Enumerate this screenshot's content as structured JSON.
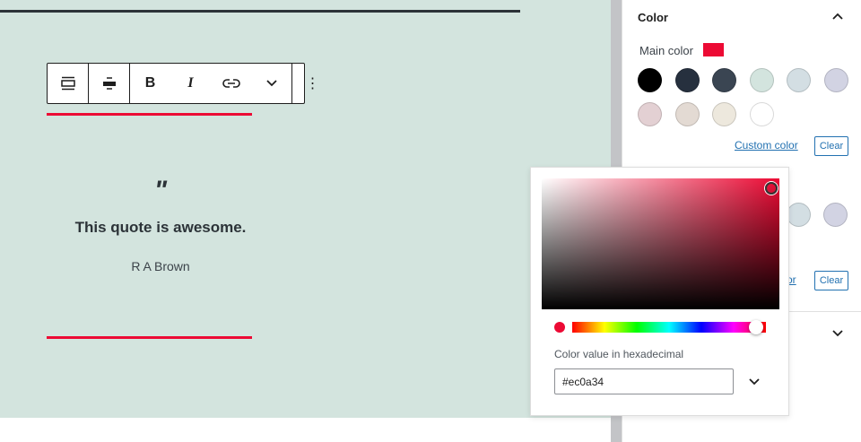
{
  "toolbar": {
    "buttons": [
      {
        "name": "block-type",
        "icon": "▭"
      },
      {
        "name": "align",
        "icon": "▬"
      },
      {
        "name": "bold",
        "icon": "B"
      },
      {
        "name": "italic",
        "icon": "I"
      },
      {
        "name": "link",
        "icon": "⊂⊃"
      },
      {
        "name": "more-rich-text",
        "icon": "⌄"
      },
      {
        "name": "options",
        "icon": "⋮"
      }
    ]
  },
  "quote": {
    "mark": "\"",
    "text": "This quote is awesome.",
    "cite": "R A Brown"
  },
  "sidebar": {
    "panel_title": "Color",
    "main_color_label": "Main color",
    "main_color": "#ec0a34",
    "palette": [
      "#000000",
      "#26303e",
      "#3a4552",
      "#d3e4de",
      "#d3dee3",
      "#d2d3e3",
      "#e3d0d3",
      "#e3dad3",
      "#ede8dd",
      "#ffffff"
    ],
    "custom_color_label": "Custom color",
    "clear_label": "Clear",
    "custom_color_partial": "or",
    "clear2_label": "Clear"
  },
  "picker": {
    "hex_label": "Color value in hexadecimal",
    "hex_value": "#ec0a34",
    "hue_fraction": 0.95
  }
}
